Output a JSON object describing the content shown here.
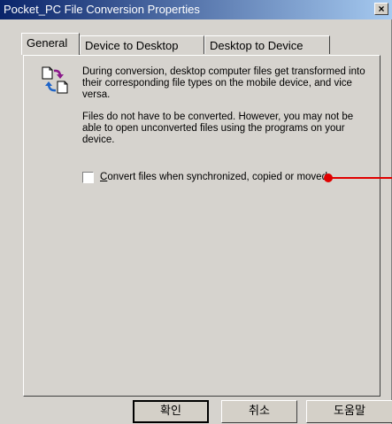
{
  "window": {
    "title": "Pocket_PC File Conversion Properties",
    "close_symbol": "×"
  },
  "tabs": [
    {
      "label": "General",
      "active": true
    },
    {
      "label": "Device to Desktop",
      "active": false
    },
    {
      "label": "Desktop to Device",
      "active": false
    }
  ],
  "general": {
    "icon": "file-conversion-icon",
    "paragraph1": "During conversion, desktop computer files get transformed into their corresponding file types on the mobile device, and vice versa.",
    "paragraph2": "Files do not have to be converted. However, you may not be able to open unconverted files using the programs on your device.",
    "checkbox": {
      "label_underlined": "C",
      "label_rest": "onvert files when synchronized, copied or moved",
      "checked": false
    }
  },
  "annotation": {
    "color": "#e00000"
  },
  "buttons": {
    "ok": "확인",
    "cancel": "취소",
    "help": "도움말"
  },
  "colors": {
    "dialog_bg": "#d6d3ce",
    "title_start": "#0a246a",
    "title_end": "#a6caf0"
  }
}
